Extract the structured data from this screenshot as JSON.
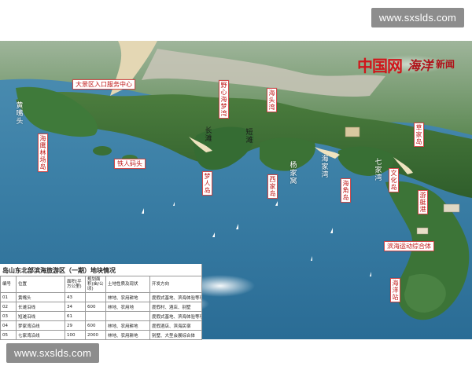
{
  "watermarks": {
    "top": "www.sxslds.com",
    "bottom": "www.sxslds.com"
  },
  "brand": {
    "part1": "中国网",
    "part2": "海洋",
    "part3": "新闻"
  },
  "labels": {
    "visitor_center": "大景区入口服务中心",
    "huangzuitou": "黄嘴头",
    "haiyingyuzhu_island": "海鹰林场岛",
    "yinrenjiutou": "铁人码头",
    "changtan": "长滩",
    "yexin_huameng_wan": "野心海梦湾",
    "duantan": "短滩",
    "huanghai_wan": "海头湾",
    "mengjia_island": "梦人岛",
    "xijiaku_island": "西家岛",
    "yangjiawo": "杨家窝",
    "haijiawan": "海家湾",
    "bolanjiao": "海角岛",
    "qijiawan": "七家湾",
    "caojia_dao": "草家岛",
    "wenhua_island": "文化岛",
    "tourist_port": "游艇港",
    "haiyang_gongyuan": "滨海运动综合体",
    "haiyuanzhan": "海洋站",
    "wanmaozhan": "万茂站"
  },
  "table": {
    "title": "岛山东北部滨海旅游区（一期）地块情况",
    "headers": [
      "编号",
      "位置",
      "面积(平方公里)",
      "规划面积(亩/公顷)",
      "土地性质及现状",
      "开发方向"
    ],
    "rows": [
      [
        "01",
        "黄嘴头",
        "43",
        "",
        "林地、农用耕地",
        "度假式基地、滨海体验等项目"
      ],
      [
        "02",
        "长滩沿线",
        "34",
        "600",
        "林地、农用地",
        "度假村、酒店、别墅"
      ],
      [
        "03",
        "短滩沿线",
        "61",
        "",
        "",
        "度假式基地、滨海体验等项目"
      ],
      [
        "04",
        "梦家湾沿线",
        "29",
        "600",
        "林地、农用耕地",
        "度假酒店、滨海民宿"
      ],
      [
        "05",
        "七家湾沿线",
        "100",
        "2000",
        "林地、农用耕地",
        "别墅、大型会展综合体"
      ]
    ]
  }
}
